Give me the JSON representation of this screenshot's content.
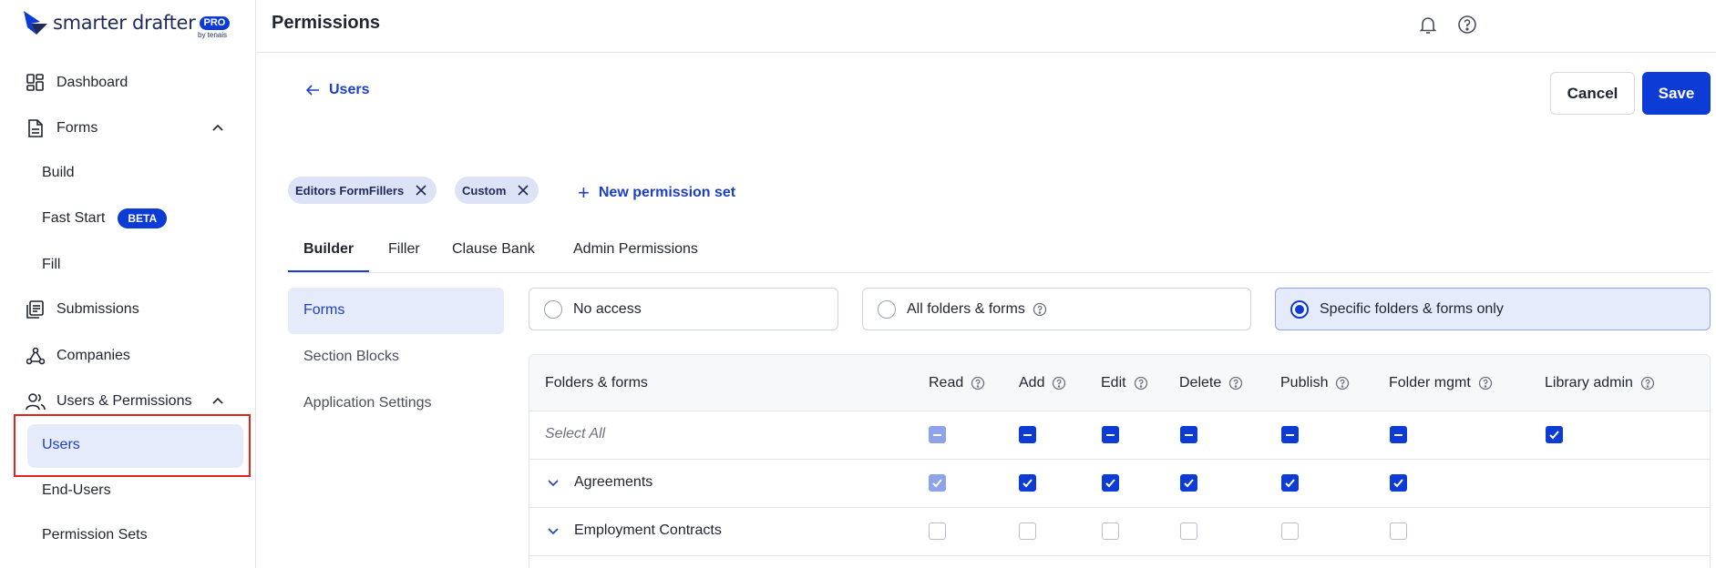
{
  "brand": {
    "name": "smarter drafter",
    "badge": "PRO",
    "byline": "by tenais"
  },
  "sidebar": {
    "dashboard": "Dashboard",
    "forms": "Forms",
    "build": "Build",
    "fast_start": "Fast Start",
    "beta": "BETA",
    "fill": "Fill",
    "submissions": "Submissions",
    "companies": "Companies",
    "users_permissions": "Users & Permissions",
    "users": "Users",
    "end_users": "End-Users",
    "permission_sets": "Permission Sets"
  },
  "topbar": {
    "title": "Permissions"
  },
  "header": {
    "back_label": "Users",
    "cancel": "Cancel",
    "save": "Save"
  },
  "chips": [
    {
      "label": "Editors FormFillers"
    },
    {
      "label": "Custom"
    }
  ],
  "new_permission_set": "New permission set",
  "tabs": [
    {
      "label": "Builder"
    },
    {
      "label": "Filler"
    },
    {
      "label": "Clause Bank"
    },
    {
      "label": "Admin Permissions"
    }
  ],
  "subnav": {
    "active": "Forms",
    "items": [
      "Section Blocks",
      "Application Settings"
    ]
  },
  "access_options": [
    {
      "label": "No access",
      "selected": false
    },
    {
      "label": "All folders & forms",
      "selected": false
    },
    {
      "label": "Specific folders & forms only",
      "selected": true
    }
  ],
  "table": {
    "columns": [
      "Folders & forms",
      "Read",
      "Add",
      "Edit",
      "Delete",
      "Publish",
      "Folder mgmt",
      "Library admin"
    ],
    "select_all": "Select All",
    "rows": [
      {
        "label": "Agreements"
      },
      {
        "label": "Employment Contracts"
      }
    ]
  },
  "colors": {
    "accent": "#0d3bd6",
    "highlight": "#e0231d",
    "active_bg": "#e6ebfb"
  }
}
